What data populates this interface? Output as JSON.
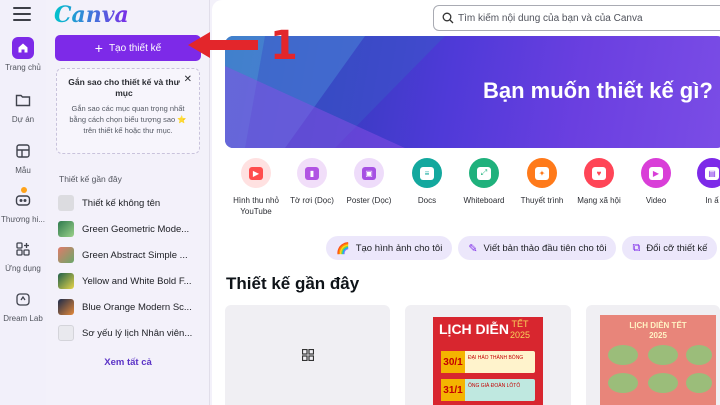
{
  "app": {
    "name": "Canva"
  },
  "rail": {
    "items": [
      {
        "label": "Trang chủ",
        "icon": "home-icon",
        "active": true
      },
      {
        "label": "Dự án",
        "icon": "folder-icon"
      },
      {
        "label": "Mẫu",
        "icon": "template-icon"
      },
      {
        "label": "Thương hi...",
        "icon": "brand-icon"
      },
      {
        "label": "Ứng dụng",
        "icon": "apps-icon"
      },
      {
        "label": "Dream Lab",
        "icon": "dreamlab-icon"
      }
    ]
  },
  "panel": {
    "create_label": "Tạo thiết kế",
    "tip": {
      "title": "Gắn sao cho thiết kế và thư mục",
      "body": "Gắn sao các mục quan trọng nhất bằng cách chọn biểu tượng sao ⭐ trên thiết kế hoặc thư mục."
    },
    "recent_heading": "Thiết kế gần đây",
    "recent": [
      {
        "label": "Thiết kế không tên",
        "color": "#dcdce0"
      },
      {
        "label": "Green Geometric Mode...",
        "color": "#3a8a5a"
      },
      {
        "label": "Green Abstract Simple ...",
        "color": "#6aa86a"
      },
      {
        "label": "Yellow and White Bold F...",
        "color": "#1f5f4a"
      },
      {
        "label": "Blue Orange Modern Sc...",
        "color": "#1b2a4a"
      },
      {
        "label": "Sơ yếu lý lịch Nhân viên...",
        "color": "#e9e9ee"
      }
    ],
    "see_all": "Xem tất cả"
  },
  "search": {
    "placeholder": "Tìm kiếm nội dung của bạn và của Canva"
  },
  "hero": {
    "title": "Bạn muốn thiết kế gì?"
  },
  "categories": [
    {
      "label": "Hình thu nhỏ YouTube",
      "color": "#ff4d4d",
      "icon": "youtube-icon"
    },
    {
      "label": "Tờ rơi (Dọc)",
      "color": "#b154e3",
      "icon": "flyer-icon"
    },
    {
      "label": "Poster (Dọc)",
      "color": "#a650e3",
      "icon": "poster-icon"
    },
    {
      "label": "Docs",
      "color": "#13a89e",
      "icon": "docs-icon"
    },
    {
      "label": "Whiteboard",
      "color": "#1fb17c",
      "icon": "whiteboard-icon"
    },
    {
      "label": "Thuyết trình",
      "color": "#ff7a1a",
      "icon": "presentation-icon"
    },
    {
      "label": "Mạng xã hội",
      "color": "#ff4557",
      "icon": "heart-icon"
    },
    {
      "label": "Video",
      "color": "#d93ed8",
      "icon": "video-icon"
    },
    {
      "label": "In ấ",
      "color": "#7d2ae8",
      "icon": "print-icon"
    }
  ],
  "chips": [
    {
      "label": "Tạo hình ảnh cho tôi",
      "icon": "rainbow-icon"
    },
    {
      "label": "Viết bản thảo đầu tiên cho tôi",
      "icon": "magic-write-icon"
    },
    {
      "label": "Đổi cỡ thiết kế",
      "icon": "resize-icon"
    }
  ],
  "recent_section_title": "Thiết kế gần đây",
  "cards": [
    {
      "name": "blank-design"
    },
    {
      "title": "LỊCH DIỄN",
      "subtitle": "TẾT 2025",
      "rows": [
        {
          "date": "30/1",
          "text": "ĐẠI HÁO THÀNH BÓNG"
        },
        {
          "date": "31/1",
          "text": "ÔNG GIÀ ĐOÀN LÔTÔ"
        }
      ]
    },
    {
      "title": "LỊCH DIỄN TẾT",
      "subtitle": "2025"
    }
  ],
  "annotation": {
    "step": "1"
  },
  "colors": {
    "accent": "#7d2ae8",
    "annotation": "#e3262b"
  }
}
